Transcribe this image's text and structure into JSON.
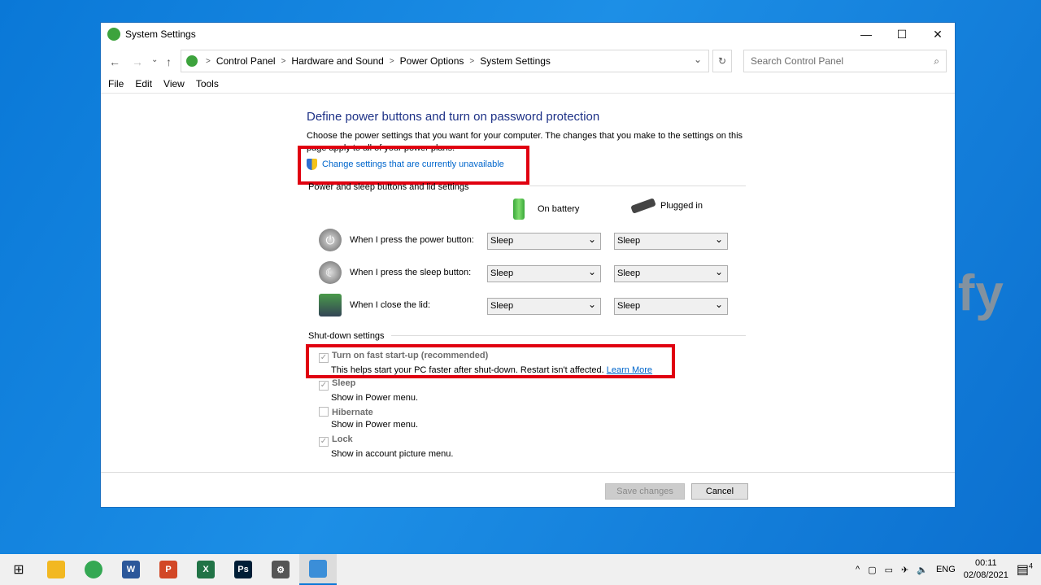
{
  "window": {
    "title": "System Settings",
    "minimize": "—",
    "maximize": "☐",
    "close": "✕"
  },
  "nav": {
    "back": "←",
    "forward": "→",
    "recent": "⌄",
    "up": "↑",
    "breadcrumbs": [
      "Control Panel",
      "Hardware and Sound",
      "Power Options",
      "System Settings"
    ],
    "dropdown": "⌄",
    "refresh": "↻",
    "search_placeholder": "Search Control Panel",
    "search_icon": "⌕"
  },
  "menu": [
    "File",
    "Edit",
    "View",
    "Tools"
  ],
  "page": {
    "heading": "Define power buttons and turn on password protection",
    "description": "Choose the power settings that you want for your computer. The changes that you make to the settings on this page apply to all of your power plans.",
    "change_link": "Change settings that are currently unavailable"
  },
  "power": {
    "section": "Power and sleep buttons and lid settings",
    "col_battery": "On battery",
    "col_plugged": "Plugged in",
    "rows": [
      {
        "label": "When I press the power button:",
        "battery": "Sleep",
        "plugged": "Sleep"
      },
      {
        "label": "When I press the sleep button:",
        "battery": "Sleep",
        "plugged": "Sleep"
      },
      {
        "label": "When I close the lid:",
        "battery": "Sleep",
        "plugged": "Sleep"
      }
    ]
  },
  "shutdown": {
    "section": "Shut-down settings",
    "items": [
      {
        "label": "Turn on fast start-up (recommended)",
        "desc": "This helps start your PC faster after shut-down. Restart isn't affected.",
        "link": "Learn More",
        "checked": true
      },
      {
        "label": "Sleep",
        "desc": "Show in Power menu.",
        "checked": true
      },
      {
        "label": "Hibernate",
        "desc": "Show in Power menu.",
        "checked": false
      },
      {
        "label": "Lock",
        "desc": "Show in account picture menu.",
        "checked": true
      }
    ]
  },
  "buttons": {
    "save": "Save changes",
    "cancel": "Cancel"
  },
  "taskbar": {
    "apps": [
      {
        "name": "file-explorer",
        "label": "",
        "color": "#f2b821"
      },
      {
        "name": "chrome",
        "label": "",
        "color": "#34a853"
      },
      {
        "name": "word",
        "label": "W",
        "color": "#2b579a"
      },
      {
        "name": "powerpoint",
        "label": "P",
        "color": "#d24726"
      },
      {
        "name": "excel",
        "label": "X",
        "color": "#217346"
      },
      {
        "name": "photoshop",
        "label": "Ps",
        "color": "#001e36"
      },
      {
        "name": "settings",
        "label": "⚙",
        "color": "#555555"
      },
      {
        "name": "control-panel",
        "label": "",
        "color": "#3b8ed8"
      }
    ],
    "lang": "ENG",
    "time": "00:11",
    "date": "02/08/2021",
    "notifications": "4"
  },
  "watermark": "uplotify"
}
